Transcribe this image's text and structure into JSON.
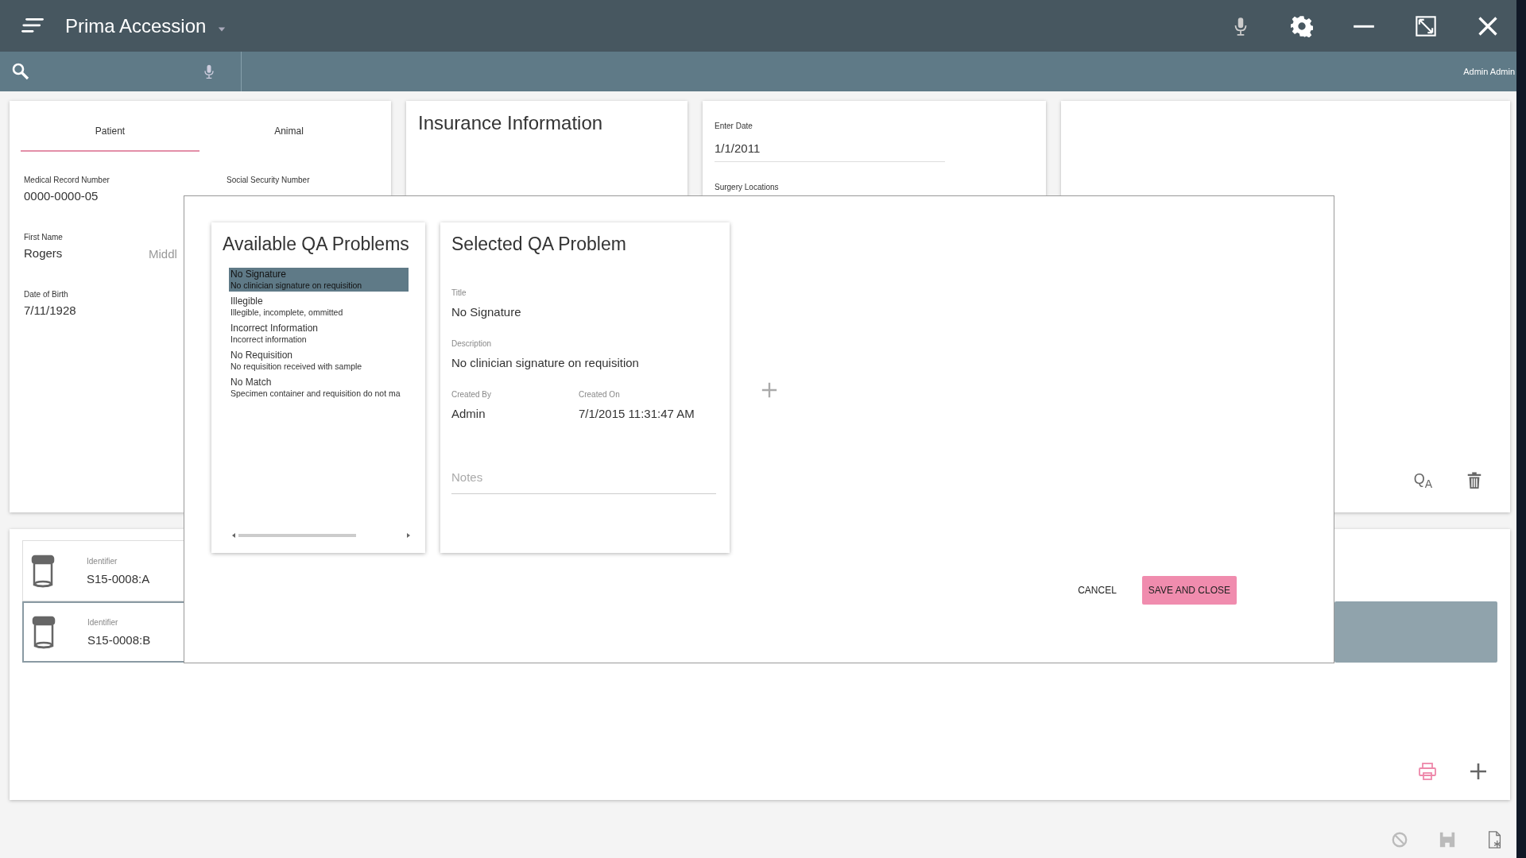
{
  "app_bar": {
    "title": "Prima Accession"
  },
  "search_bar": {
    "user": "Admin Admin"
  },
  "patient_card": {
    "tabs": [
      {
        "label": "Patient",
        "selected": true
      },
      {
        "label": "Animal",
        "selected": false
      }
    ],
    "fields": [
      {
        "label": "Medical Record Number",
        "value": "0000-0000-05"
      },
      {
        "label": "Social Security Number"
      },
      {
        "label": "First Name",
        "value": "Rogers"
      },
      {
        "placeholder": "Middl"
      },
      {
        "label": "Date of Birth",
        "value": "7/11/1928"
      }
    ]
  },
  "detail_card": {
    "qa_button": {
      "main": "Q",
      "subscript": "A"
    }
  },
  "insurance_card": {
    "title": "Insurance Information"
  },
  "date_card": {
    "fields": [
      {
        "label": "Enter Date",
        "value": "1/1/2011"
      },
      {
        "label": "Surgery Locations"
      }
    ]
  },
  "specimens": [
    {
      "label": "Identifier",
      "value": "S15-0008:A",
      "selected": false
    },
    {
      "label": "Identifier",
      "value": "S15-0008:B",
      "selected": true
    }
  ],
  "dialog": {
    "available": {
      "title": "Available QA Problems",
      "items": [
        {
          "name": "No Signature",
          "description": "No clinician signature on requisition",
          "selected": true
        },
        {
          "name": "Illegible",
          "description": "Illegible, incomplete, ommitted",
          "selected": false
        },
        {
          "name": "Incorrect Information",
          "description": "Incorrect information",
          "selected": false
        },
        {
          "name": "No Requisition",
          "description": "No requisition received with sample",
          "selected": false
        },
        {
          "name": "No Match",
          "description": "Specimen container and requisition do not ma",
          "selected": false
        }
      ]
    },
    "selected_problem": {
      "title": "Selected QA Problem",
      "fields": [
        {
          "label": "Title",
          "value": "No Signature"
        },
        {
          "label": "Description",
          "value": "No clinician signature on requisition"
        },
        {
          "label": "Created By",
          "value": "Admin"
        },
        {
          "label": "Created On",
          "value": "7/1/2015 11:31:47 AM"
        }
      ],
      "notes": {
        "placeholder": "Notes"
      }
    },
    "buttons": [
      {
        "label": "CANCEL",
        "kind": "text"
      },
      {
        "label": "SAVE AND CLOSE",
        "kind": "primary"
      }
    ]
  }
}
